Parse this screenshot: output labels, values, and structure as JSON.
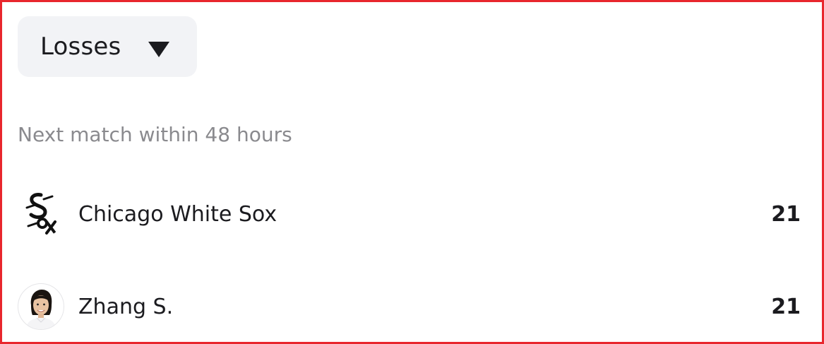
{
  "filter": {
    "selected": "Losses",
    "arrow_icon": "triangle-down-icon"
  },
  "section": {
    "title": "Next match within 48 hours"
  },
  "rows": [
    {
      "name": "Chicago White Sox",
      "value": "21",
      "icon": "white-sox-logo-icon"
    },
    {
      "name": "Zhang S.",
      "value": "21",
      "icon": "player-avatar-icon"
    }
  ],
  "colors": {
    "border_accent": "#e8262d",
    "dropdown_bg": "#f2f3f6",
    "text_primary": "#1b1b1f",
    "text_secondary": "#8a8a8e"
  }
}
